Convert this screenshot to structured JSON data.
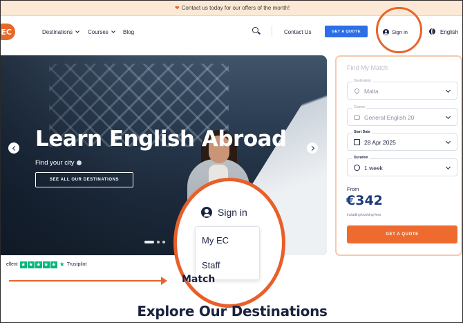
{
  "promo": {
    "text": "Contact us today for our offers of the month!"
  },
  "nav": {
    "logo_text": "EC",
    "links": [
      {
        "label": "Destinations"
      },
      {
        "label": "Courses"
      },
      {
        "label": "Blog"
      }
    ],
    "contact_label": "Contact Us",
    "quote_label": "GET A QUOTE",
    "signin_label": "Sign in",
    "language_label": "English"
  },
  "hero": {
    "title": "Learn English Abroad",
    "subtitle": "Find your city",
    "cta_label": "SEE ALL OUR DESTINATIONS"
  },
  "match_panel": {
    "title": "Find My Match",
    "fields": [
      {
        "label": "Destination",
        "value": "Malta",
        "icon": "location-pin-icon"
      },
      {
        "label": "Course",
        "value": "General English 20",
        "icon": "graduation-cap-icon"
      },
      {
        "label": "Start Date",
        "value": "28 Apr 2025",
        "icon": "calendar-icon"
      },
      {
        "label": "Duration",
        "value": "1 week",
        "icon": "clock-icon"
      }
    ],
    "from_label": "From",
    "price": "€342",
    "fees_note": "including booking fees",
    "quote_label": "GET A QUOTE"
  },
  "trustpilot": {
    "rating_text": "ellent",
    "brand": "Trustpilot"
  },
  "callout": {
    "signin_label": "Sign in",
    "menu_items": [
      "My EC",
      "Staff"
    ],
    "partial_heading": "Match"
  },
  "section": {
    "heading": "Explore Our Destinations"
  },
  "colors": {
    "accent_orange": "#e8642a",
    "brand_blue": "#2c6ee8",
    "navy": "#1b2240",
    "trustpilot_green": "#00b67a"
  }
}
